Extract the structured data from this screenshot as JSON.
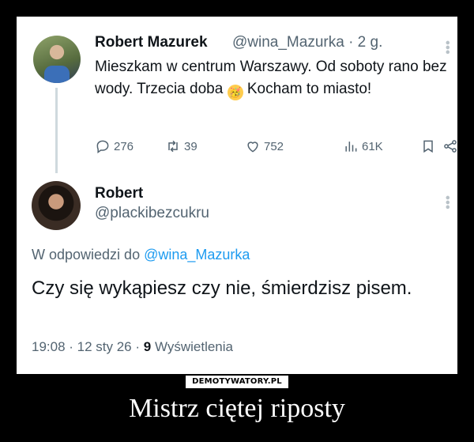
{
  "tweet1": {
    "name": "Robert Mazurek",
    "handle": "@wina_Mazurka · 2 g.",
    "text_before_emoji": "Mieszkam w centrum Warszawy. Od soboty rano bez wody. Trzecia doba",
    "emoji": "🥳",
    "text_after_emoji": " Kocham to miasto!",
    "actions": {
      "reply_count": "276",
      "retweet_count": "39",
      "like_count": "752",
      "views_count": "61K"
    }
  },
  "tweet2": {
    "name": "Robert",
    "handle": "@plackibezcukru",
    "replying_prefix": "W odpowiedzi do ",
    "replying_to": "@wina_Mazurka",
    "text": "Czy się wykąpiesz czy nie, śmierdzisz pisem.",
    "time": "19:08 · 12 sty 26 · ",
    "views_count": "9",
    "views_label": " Wyświetlenia"
  },
  "watermark": "DEMOTYWATORY.PL",
  "caption": "Mistrz ciętej riposty",
  "colors": {
    "link": "#1d9bf0",
    "muted": "#536471",
    "text": "#0f1419",
    "background": "#000000"
  }
}
